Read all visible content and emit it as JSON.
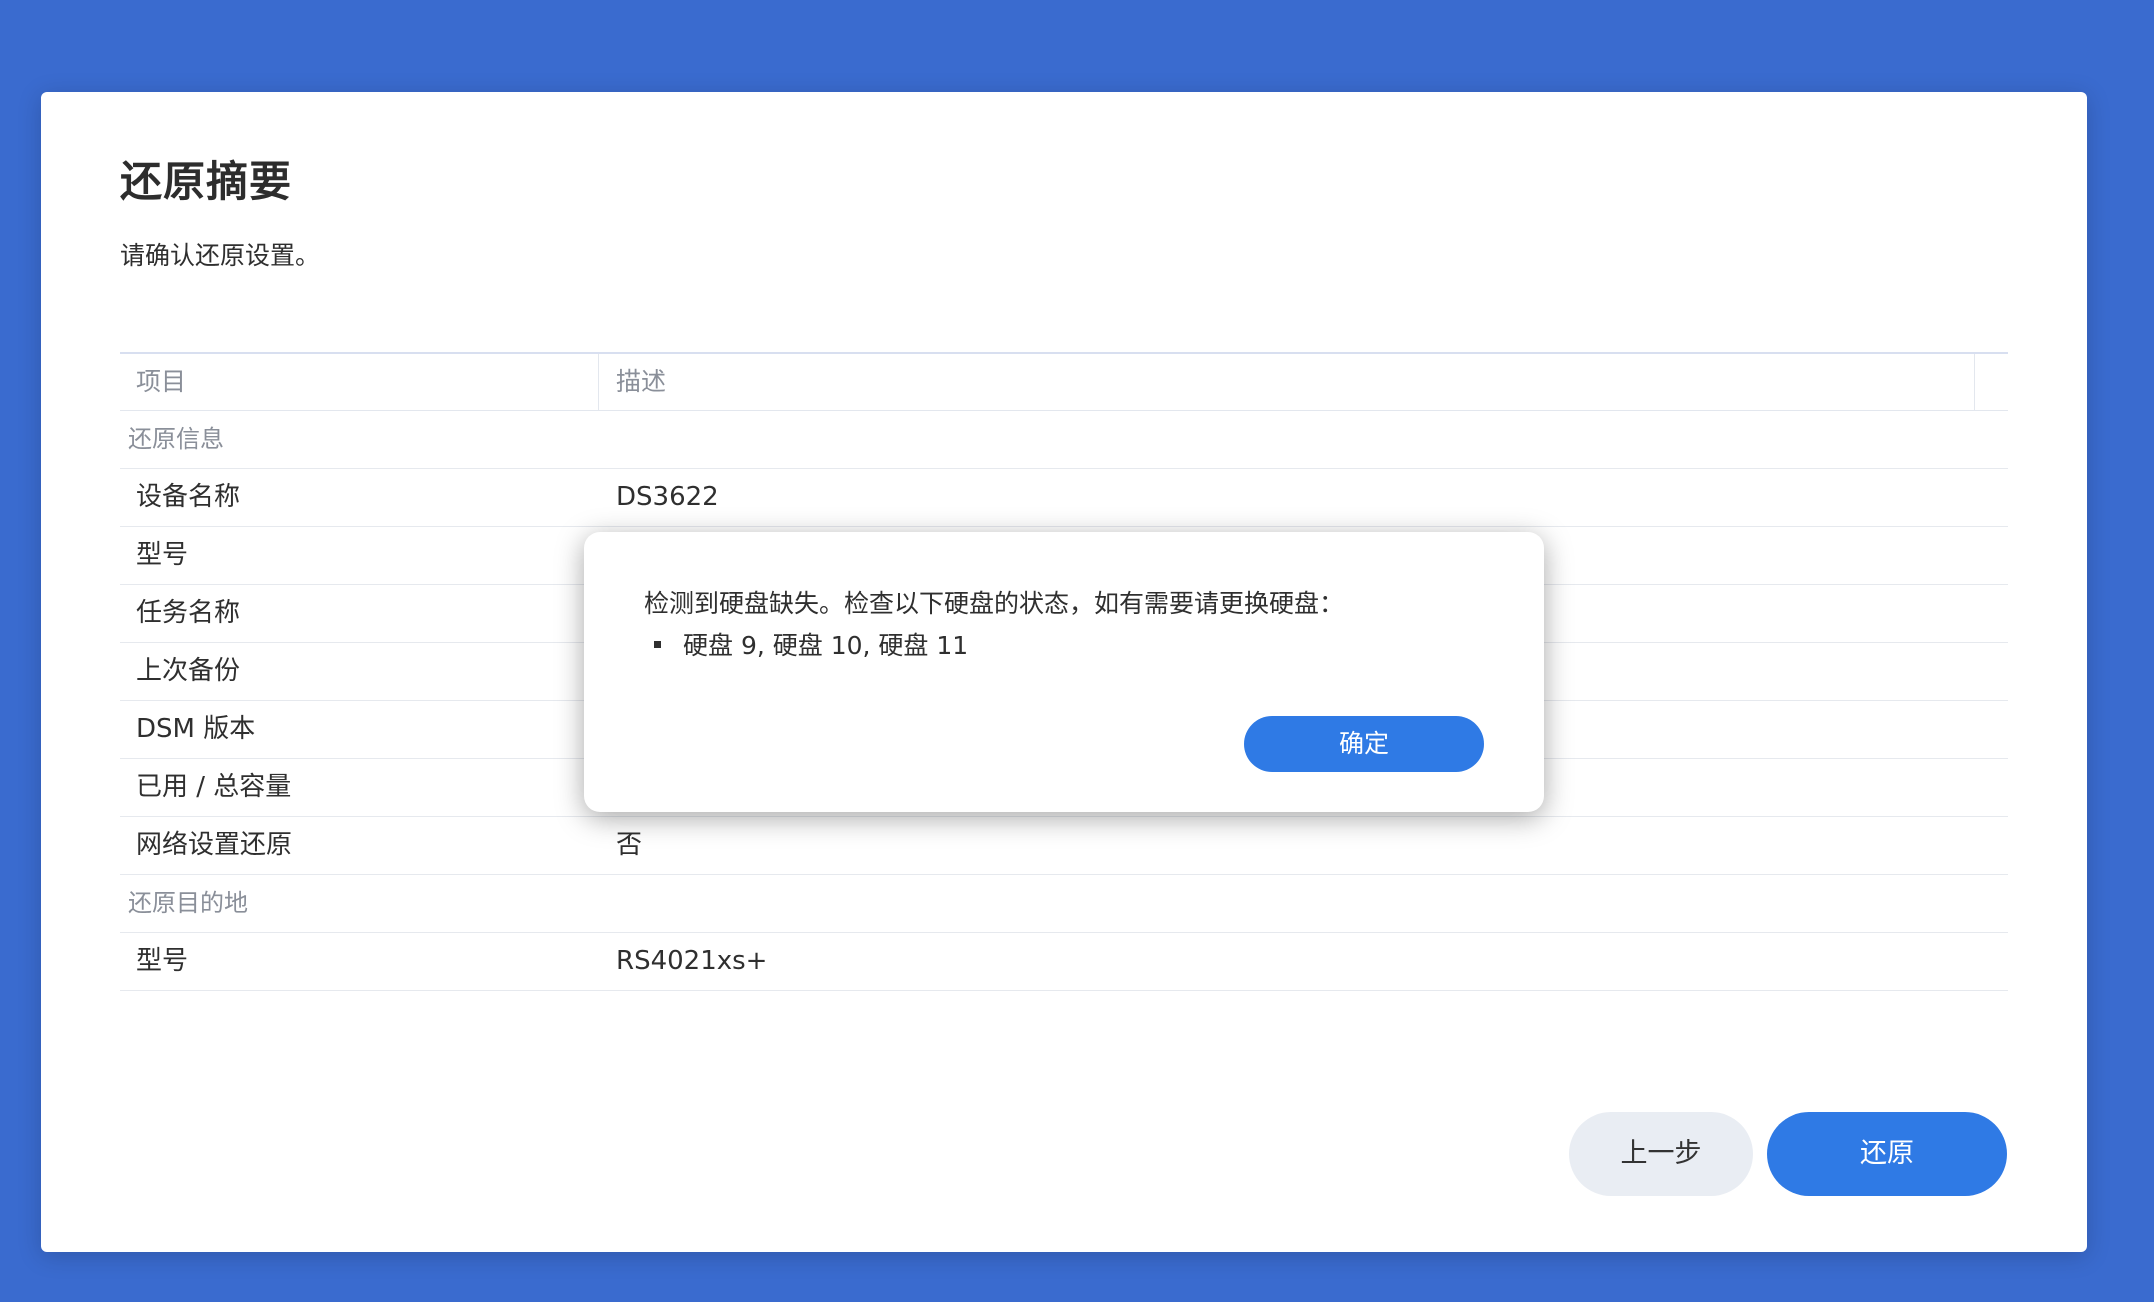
{
  "page": {
    "title": "还原摘要",
    "subtitle": "请确认还原设置。"
  },
  "table": {
    "headers": {
      "item": "项目",
      "desc": "描述"
    },
    "groups": [
      {
        "label": "还原信息",
        "rows": [
          {
            "key": "设备名称",
            "value": "DS3622"
          },
          {
            "key": "型号",
            "value": ""
          },
          {
            "key": "任务名称",
            "value": ""
          },
          {
            "key": "上次备份",
            "value": ""
          },
          {
            "key": "DSM 版本",
            "value": ""
          },
          {
            "key": "已用 / 总容量",
            "value": ""
          },
          {
            "key": "网络设置还原",
            "value": "否"
          }
        ]
      },
      {
        "label": "还原目的地",
        "rows": [
          {
            "key": "型号",
            "value": "RS4021xs+"
          }
        ]
      }
    ]
  },
  "buttons": {
    "prev": "上一步",
    "restore": "还原"
  },
  "dialog": {
    "message": "检测到硬盘缺失。检查以下硬盘的状态，如有需要请更换硬盘：",
    "list_item": "硬盘 9, 硬盘 10, 硬盘 11",
    "ok_label": "确定"
  }
}
